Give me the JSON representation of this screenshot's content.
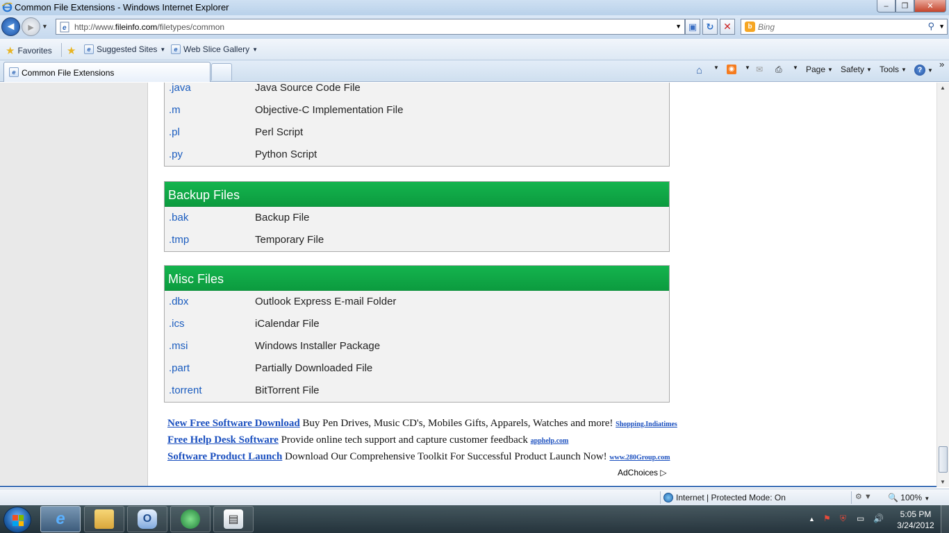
{
  "window": {
    "title": "Common File Extensions - Windows Internet Explorer",
    "min_glyph": "–",
    "max_glyph": "❐",
    "close_glyph": "✕"
  },
  "nav": {
    "back_glyph": "◄",
    "forward_glyph": "►",
    "url_prefix": "http://www.",
    "url_domain": "fileinfo.com",
    "url_path": "/filetypes/common",
    "search_placeholder": "Bing",
    "search_icon": "magnifier-icon",
    "refresh_glyph": "↻",
    "stop_glyph": "✕"
  },
  "favorites_bar": {
    "favorites_label": "Favorites",
    "items": [
      {
        "label": "Suggested Sites",
        "has_dropdown": true
      },
      {
        "label": "Web Slice Gallery",
        "has_dropdown": true
      }
    ]
  },
  "tabs": [
    {
      "label": "Common File Extensions",
      "active": true
    }
  ],
  "command_bar": {
    "page_label": "Page",
    "safety_label": "Safety",
    "tools_label": "Tools",
    "help_glyph": "?",
    "overflow_glyph": "»"
  },
  "sections": [
    {
      "title": "",
      "rows": [
        {
          "ext": ".java",
          "desc": "Java Source Code File"
        },
        {
          "ext": ".m",
          "desc": "Objective-C Implementation File"
        },
        {
          "ext": ".pl",
          "desc": "Perl Script"
        },
        {
          "ext": ".py",
          "desc": "Python Script"
        }
      ]
    },
    {
      "title": "Backup Files",
      "rows": [
        {
          "ext": ".bak",
          "desc": "Backup File"
        },
        {
          "ext": ".tmp",
          "desc": "Temporary File"
        }
      ]
    },
    {
      "title": "Misc Files",
      "rows": [
        {
          "ext": ".dbx",
          "desc": "Outlook Express E-mail Folder"
        },
        {
          "ext": ".ics",
          "desc": "iCalendar File"
        },
        {
          "ext": ".msi",
          "desc": "Windows Installer Package"
        },
        {
          "ext": ".part",
          "desc": "Partially Downloaded File"
        },
        {
          "ext": ".torrent",
          "desc": "BitTorrent File"
        }
      ]
    }
  ],
  "ads": [
    {
      "link": "New Free Software Download",
      "text": "Buy Pen Drives, Music CD's, Mobiles Gifts, Apparels, Watches and more!",
      "domain": "Shopping.Indiatimes"
    },
    {
      "link": "Free Help Desk Software",
      "text": "Provide online tech support and capture customer feedback",
      "domain": "apphelp.com"
    },
    {
      "link": "Software Product Launch",
      "text": "Download Our Comprehensive Toolkit For Successful Product Launch Now!",
      "domain": "www.280Group.com"
    }
  ],
  "adchoices_label": "AdChoices ▷",
  "status": {
    "zone_text": "Internet | Protected Mode: On",
    "zoom_text": "100%"
  },
  "taskbar": {
    "apps": [
      "internet-explorer",
      "windows-explorer",
      "outlook",
      "globe-app",
      "reader-app"
    ],
    "time": "5:05 PM",
    "date": "3/24/2012"
  },
  "colors": {
    "section_header": "#10a847",
    "link_blue": "#1a5cbf",
    "accent": "#3c6fb6"
  }
}
